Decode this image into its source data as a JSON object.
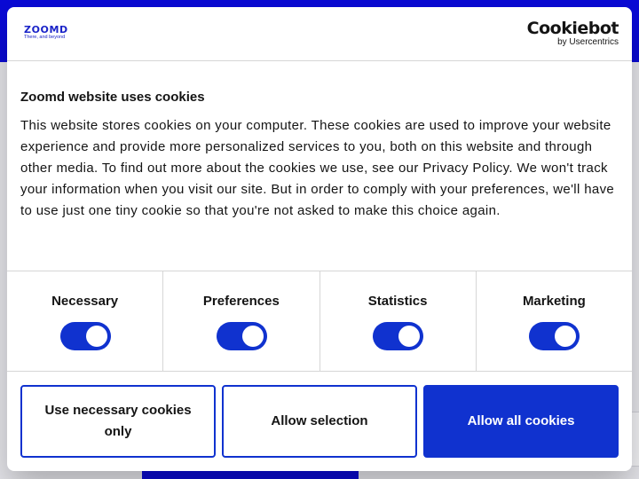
{
  "brand": {
    "name": "ZOOMD",
    "tagline": "There, and beyond"
  },
  "consent_provider": {
    "wordmark": "Cookiebot",
    "sub": "by Usercentrics"
  },
  "dialog": {
    "title": "Zoomd website uses cookies",
    "body": "This website stores cookies on your computer. These cookies are used to improve your website experience and provide more personalized services to you, both on this website and through other media. To find out more about the cookies we use, see our Privacy Policy. We won't track your information when you visit our site. But in order to comply with your preferences, we'll have to use just one tiny cookie so that you're not asked to make this choice again."
  },
  "categories": [
    {
      "label": "Necessary",
      "enabled": true
    },
    {
      "label": "Preferences",
      "enabled": true
    },
    {
      "label": "Statistics",
      "enabled": true
    },
    {
      "label": "Marketing",
      "enabled": true
    }
  ],
  "buttons": {
    "necessary_only": "Use necessary cookies only",
    "allow_selection": "Allow selection",
    "allow_all": "Allow all cookies"
  },
  "colors": {
    "accent": "#1032cf",
    "page_header": "#0a0ad6"
  }
}
